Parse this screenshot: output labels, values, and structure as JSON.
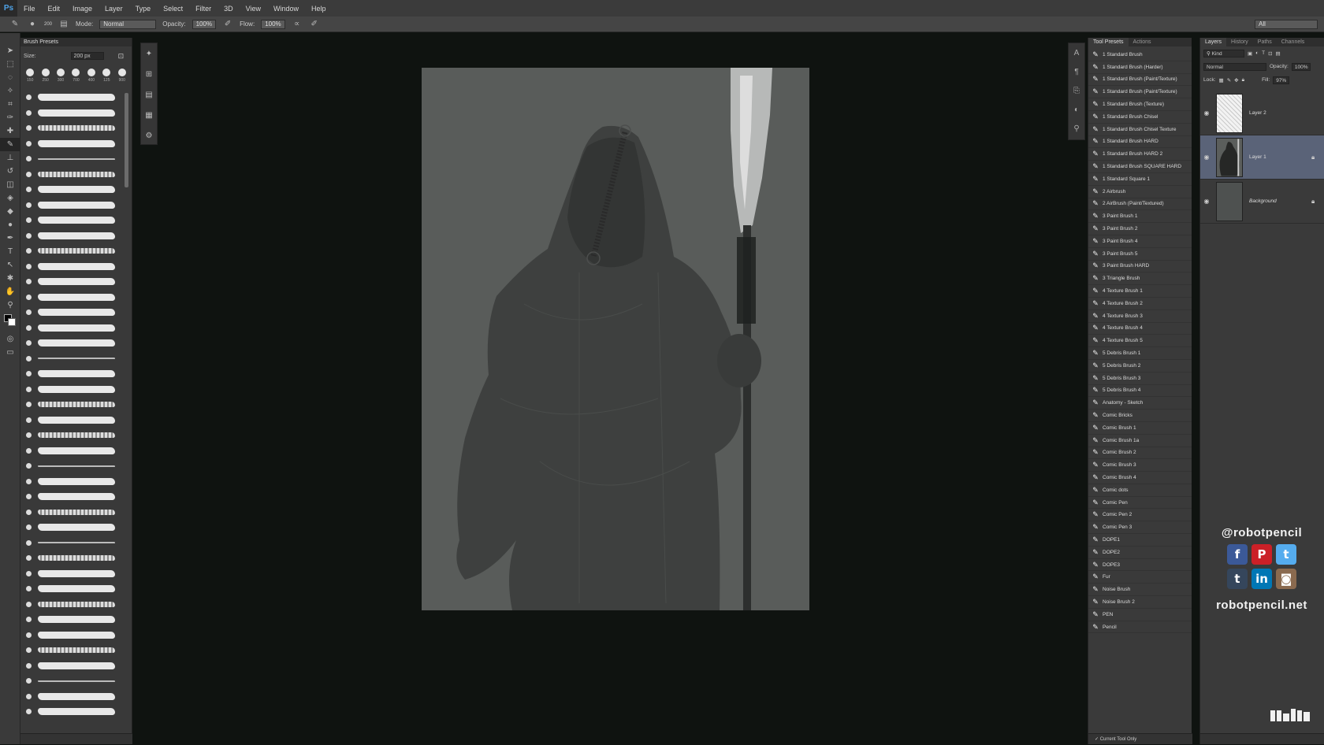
{
  "app": {
    "logo": "Ps"
  },
  "menu": [
    "File",
    "Edit",
    "Image",
    "Layer",
    "Type",
    "Select",
    "Filter",
    "3D",
    "View",
    "Window",
    "Help"
  ],
  "options": {
    "brush_size": "200",
    "mode_label": "Mode:",
    "mode_value": "Normal",
    "opacity_label": "Opacity:",
    "opacity_value": "100%",
    "flow_label": "Flow:",
    "flow_value": "100%",
    "workspace": "All"
  },
  "brush_presets": {
    "title": "Brush Presets",
    "size_label": "Size:",
    "size_value": "200 px",
    "tips": [
      "150",
      "250",
      "300",
      "700",
      "400",
      "125",
      "900"
    ]
  },
  "tool_presets": {
    "tabs": [
      "Tool Presets",
      "Actions"
    ],
    "items": [
      "1 Standard Brush",
      "1 Standard Brush (Harder)",
      "1 Standard Brush (Paint/Texture)",
      "1 Standard Brush (Paint/Texture)",
      "1 Standard Brush (Texture)",
      "1 Standard Brush Chisel",
      "1 Standard Brush Chisel Texture",
      "1 Standard Brush HARD",
      "1 Standard Brush HARD 2",
      "1 Standard Brush SQUARE HARD",
      "1 Standard Square 1",
      "2 Airbrush",
      "2 AirBrush (Paint/Textured)",
      "3 Paint Brush 1",
      "3 Paint Brush 2",
      "3 Paint Brush 4",
      "3 Paint Brush 5",
      "3 Paint Brush HARD",
      "3 Triangle Brush",
      "4 Texture Brush 1",
      "4 Texture Brush 2",
      "4 Texture Brush 3",
      "4 Texture Brush 4",
      "4 Texture Brush 5",
      "5 Debris Brush 1",
      "5 Debris Brush 2",
      "5 Debris Brush 3",
      "5 Debris Brush 4",
      "Anatomy - Sketch",
      "Comic Bricks",
      "Comic Brush 1",
      "Comic Brush 1a",
      "Comic Brush 2",
      "Comic Brush 3",
      "Comic Brush 4",
      "Comic dots",
      "Comic Pen",
      "Comic Pen 2",
      "Comic Pen 3",
      "DOPE1",
      "DOPE2",
      "DOPE3",
      "Fur",
      "Noise Brush",
      "Noise Brush 2",
      "PEN",
      "Pencil"
    ],
    "footer": "Current Tool Only"
  },
  "layers_panel": {
    "tabs": [
      "Layers",
      "History",
      "Paths",
      "Channels"
    ],
    "filter": "Kind",
    "blend_mode": "Normal",
    "opacity_label": "Opacity:",
    "opacity_value": "100%",
    "lock_label": "Lock:",
    "fill_label": "Fill:",
    "fill_value": "97%",
    "layers": [
      {
        "name": "Layer 2"
      },
      {
        "name": "Layer 1"
      },
      {
        "name": "Background"
      }
    ]
  },
  "branding": {
    "handle": "@robotpencil",
    "website": "robotpencil.net",
    "social": [
      {
        "icon": "facebook-icon",
        "glyph": "f",
        "color": "#3b5998"
      },
      {
        "icon": "pinterest-icon",
        "glyph": "P",
        "color": "#cb2027"
      },
      {
        "icon": "twitter-icon",
        "glyph": "t",
        "color": "#55acee"
      },
      {
        "icon": "tumblr-icon",
        "glyph": "t",
        "color": "#35465c"
      },
      {
        "icon": "linkedin-icon",
        "glyph": "in",
        "color": "#0077b5"
      },
      {
        "icon": "instagram-icon",
        "glyph": "◙",
        "color": "#8a6a4f"
      }
    ]
  },
  "colors": {
    "foreground": "#000000",
    "background": "#ffffff",
    "canvas": "#595c5a",
    "selected_layer": "#5a6378"
  }
}
